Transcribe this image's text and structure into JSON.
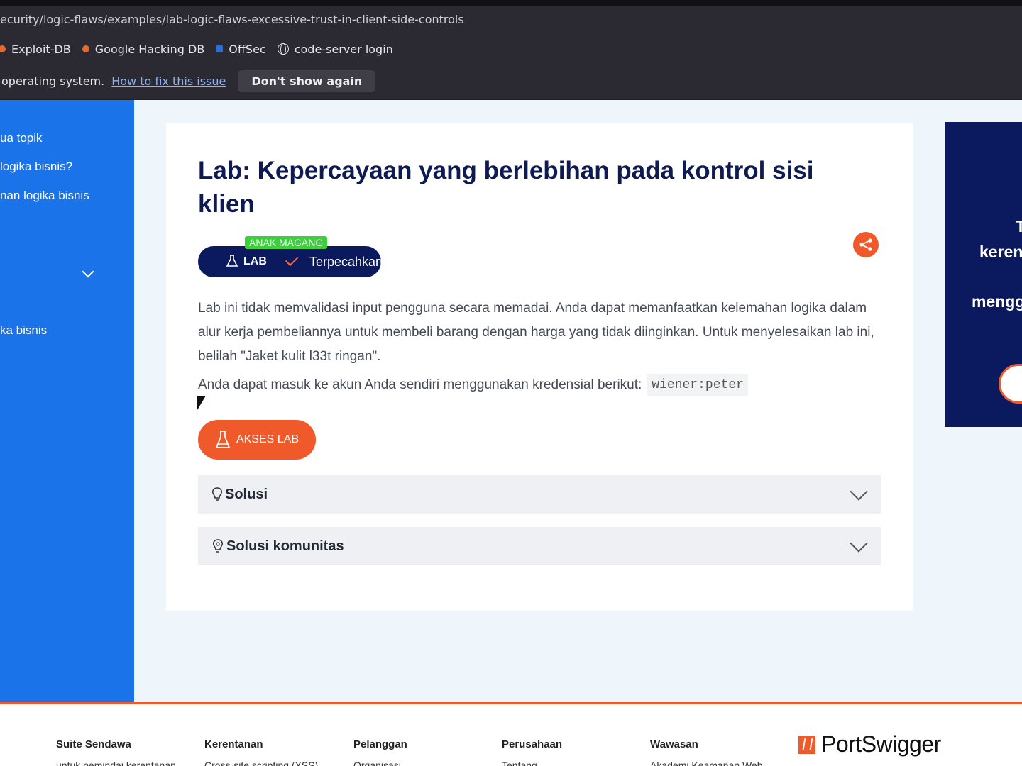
{
  "browser": {
    "url": "ecurity/logic-flaws/examples/lab-logic-flaws-excessive-trust-in-client-side-controls",
    "bookmarks": [
      {
        "label": "Exploit-DB",
        "icon": "exploit-db-icon"
      },
      {
        "label": "Google Hacking DB",
        "icon": "ghdb-icon"
      },
      {
        "label": "OffSec",
        "icon": "offsec-icon"
      },
      {
        "label": "code-server login",
        "icon": "globe-icon"
      }
    ],
    "infobar": {
      "message": "operating system.",
      "link": "How to fix this issue",
      "dismiss": "Don't show again"
    }
  },
  "sidebar": {
    "items": [
      "ua topik",
      "logika bisnis?",
      "nan logika bisnis",
      "ka bisnis"
    ]
  },
  "lab": {
    "title": "Lab: Kepercayaan yang berlebihan pada kontrol sisi klien",
    "level_tag": "ANAK MAGANG",
    "lab_label": "LAB",
    "status": "Terpecahkan",
    "description": "Lab ini tidak memvalidasi input pengguna secara memadai. Anda dapat memanfaatkan kelemahan logika dalam alur kerja pembeliannya untuk membeli barang dengan harga yang tidak diinginkan. Untuk menyelesaikan lab ini, belilah \"Jaket kulit l33t ringan\".",
    "credentials_text": "Anda dapat masuk ke akun Anda sendiri menggunakan kredensial berikut:",
    "credentials": "wiener:peter",
    "access_button": "AKSES LAB",
    "accordions": [
      "Solusi",
      "Solusi komunitas"
    ]
  },
  "promo": {
    "line1": "T",
    "line2": "keren",
    "line3": "mengg"
  },
  "footer": {
    "columns": [
      {
        "title": "Suite Sendawa",
        "sub": "untuk pemindai kerentanan"
      },
      {
        "title": "Kerentanan",
        "sub": "Cross-site scripting (XSS)"
      },
      {
        "title": "Pelanggan",
        "sub": "Organisasi"
      },
      {
        "title": "Perusahaan",
        "sub": "Tentang"
      },
      {
        "title": "Wawasan",
        "sub": "Akademi Keamanan Web"
      }
    ],
    "logo": "PortSwigger"
  },
  "colors": {
    "accent": "#f05a2a",
    "navy": "#0b1a5e",
    "sidebar": "#1a73e8",
    "badge_green": "#3bd13b"
  }
}
